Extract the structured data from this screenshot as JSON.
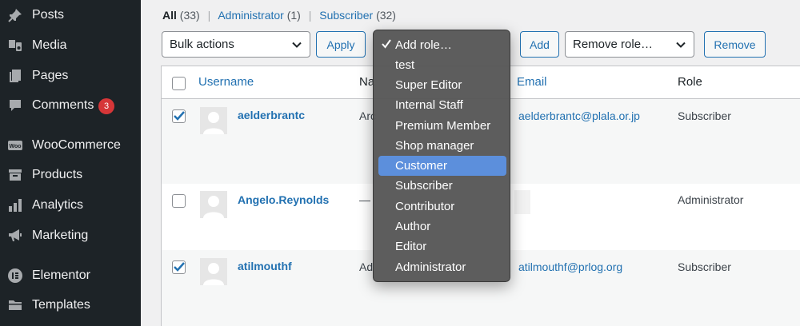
{
  "sidebar": {
    "items": [
      {
        "label": "Posts",
        "icon": "pin-icon"
      },
      {
        "label": "Media",
        "icon": "media-icon"
      },
      {
        "label": "Pages",
        "icon": "pages-icon"
      },
      {
        "label": "Comments",
        "icon": "comments-icon",
        "badge": "3"
      },
      {
        "label": "WooCommerce",
        "icon": "woocommerce-icon"
      },
      {
        "label": "Products",
        "icon": "products-icon"
      },
      {
        "label": "Analytics",
        "icon": "analytics-icon"
      },
      {
        "label": "Marketing",
        "icon": "megaphone-icon"
      },
      {
        "label": "Elementor",
        "icon": "elementor-icon"
      },
      {
        "label": "Templates",
        "icon": "folder-icon"
      }
    ]
  },
  "views": {
    "all_label": "All",
    "all_count": "(33)",
    "admin_label": "Administrator",
    "admin_count": "(1)",
    "subscriber_label": "Subscriber",
    "subscriber_count": "(32)",
    "separator": "|"
  },
  "toolbar": {
    "bulk_actions": "Bulk actions",
    "apply": "Apply",
    "add": "Add",
    "remove_role": "Remove role…",
    "remove": "Remove"
  },
  "table": {
    "headers": {
      "username": "Username",
      "name": "Na",
      "email": "Email",
      "role": "Role"
    },
    "rows": [
      {
        "username": "aelderbrantc",
        "name": "Arc",
        "email": "aelderbrantc@plala.or.jp",
        "role": "Subscriber",
        "checked": true
      },
      {
        "username": "Angelo.Reynolds",
        "name": "—",
        "email": "",
        "role": "Administrator",
        "checked": false
      },
      {
        "username": "atilmouthf",
        "name": "Ad",
        "email": "atilmouthf@prlog.org",
        "role": "Subscriber",
        "checked": true
      }
    ]
  },
  "role_menu": {
    "selected": "Add role…",
    "highlighted": "Customer",
    "options": [
      "Add role…",
      "test",
      "Super Editor",
      "Internal Staff",
      "Premium Member",
      "Shop manager",
      "Customer",
      "Subscriber",
      "Contributor",
      "Author",
      "Editor",
      "Administrator"
    ]
  },
  "colors": {
    "accent": "#2271b1",
    "sidebar": "#1d2327",
    "badge": "#d63638",
    "menu_highlight": "#5c8fdc"
  }
}
